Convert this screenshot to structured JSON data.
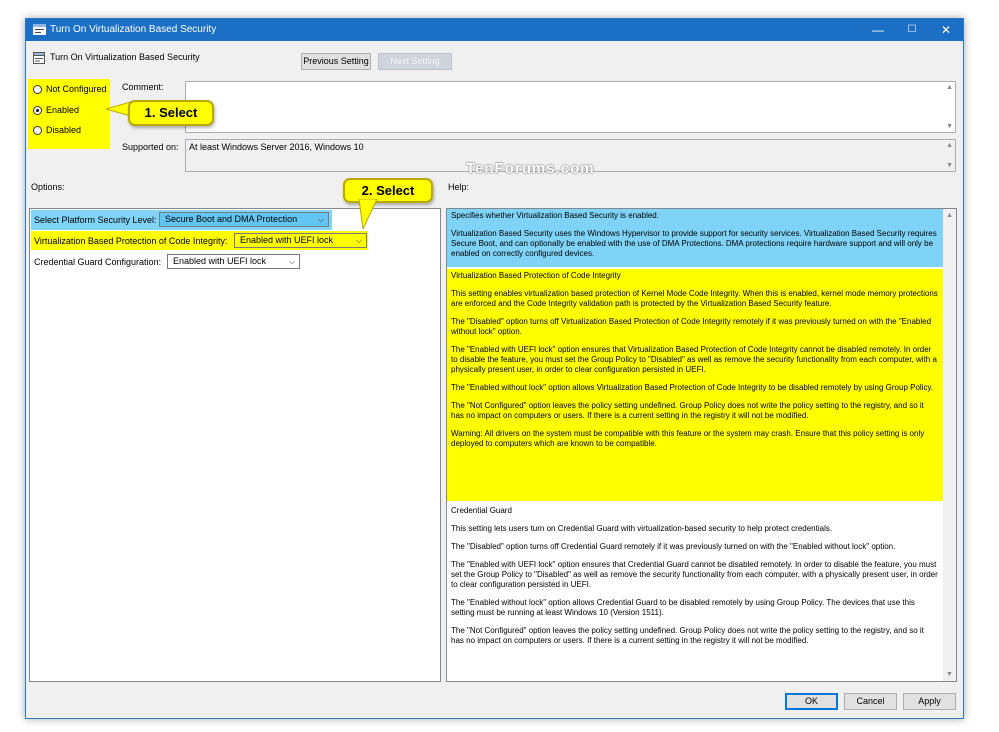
{
  "window": {
    "title": "Turn On Virtualization Based Security",
    "minimize_glyph": "—",
    "maximize_glyph": "☐",
    "close_glyph": "✕"
  },
  "header": {
    "setting_name": "Turn On Virtualization Based Security",
    "previous_label": "Previous Setting",
    "next_label": "Next Setting"
  },
  "state": {
    "options": [
      {
        "label": "Not Configured",
        "checked": false
      },
      {
        "label": "Enabled",
        "checked": true
      },
      {
        "label": "Disabled",
        "checked": false
      }
    ]
  },
  "comment": {
    "label": "Comment:",
    "value": ""
  },
  "supported": {
    "label": "Supported on:",
    "value": "At least Windows Server 2016, Windows 10"
  },
  "watermark": "TenForums.com",
  "options_panel": {
    "heading": "Options:",
    "rows": [
      {
        "label": "Select Platform Security Level:",
        "value": "Secure Boot and DMA Protection"
      },
      {
        "label": "Virtualization Based Protection of Code Integrity:",
        "value": "Enabled with UEFI lock"
      },
      {
        "label": "Credential Guard Configuration:",
        "value": "Enabled with UEFI lock"
      }
    ]
  },
  "help": {
    "heading": "Help:",
    "blue": [
      "Specifies whether Virtualization Based Security is enabled.",
      "Virtualization Based Security uses the Windows Hypervisor to provide support for security services. Virtualization Based Security requires Secure Boot, and can optionally be enabled with the use of DMA Protections. DMA protections require hardware support and will only be enabled on correctly configured devices."
    ],
    "yellow": [
      "Virtualization Based Protection of Code Integrity",
      "This setting enables virtualization based protection of Kernel Mode Code Integrity. When this is enabled, kernel mode memory protections are enforced and the Code Integrity validation path is protected by the Virtualization Based Security feature.",
      "The \"Disabled\" option turns off Virtualization Based Protection of Code Integrity remotely if it was previously turned on with the \"Enabled without lock\" option.",
      "The \"Enabled with UEFI lock\" option ensures that Virtualization Based Protection of Code Integrity cannot be disabled remotely. In order to disable the feature, you must set the Group Policy to \"Disabled\" as well as remove the security functionality from each computer, with a physically present user, in order to clear configuration persisted in UEFI.",
      "The \"Enabled without lock\" option allows Virtualization Based Protection of Code Integrity to be disabled remotely by using Group Policy.",
      "The \"Not Configured\" option leaves the policy setting undefined. Group Policy does not write the policy setting to the registry, and so it has no impact on computers or users. If there is a current setting in the registry it will not be modified.",
      "Warning: All drivers on the system must be compatible with this feature or the system may crash. Ensure that this policy setting is only deployed to computers which are known to be compatible."
    ],
    "white": [
      "Credential Guard",
      "This setting lets users turn on Credential Guard with virtualization-based security to help protect credentials.",
      "The \"Disabled\" option turns off Credential Guard remotely if it was previously turned on with the \"Enabled without lock\" option.",
      "The \"Enabled with UEFI lock\" option ensures that Credential Guard cannot be disabled remotely. In order to disable the feature, you must set the Group Policy to \"Disabled\" as well as remove the security functionality from each computer, with a physically present user, in order to clear configuration persisted in UEFI.",
      "The \"Enabled without lock\" option allows Credential Guard to be disabled remotely by using Group Policy. The devices that use this setting must be running at least Windows 10 (Version 1511).",
      "The \"Not Configured\" option leaves the policy setting undefined. Group Policy does not write the policy setting to the registry, and so it has no impact on computers or users. If there is a current setting in the registry it will not be modified."
    ]
  },
  "footer": {
    "ok_label": "OK",
    "cancel_label": "Cancel",
    "apply_label": "Apply"
  },
  "callouts": {
    "first": "1. Select",
    "second": "2. Select"
  },
  "colors": {
    "titlebar": "#1b6fc5",
    "highlight_yellow": "#ffff00",
    "help_blue": "#7fd3f7"
  }
}
